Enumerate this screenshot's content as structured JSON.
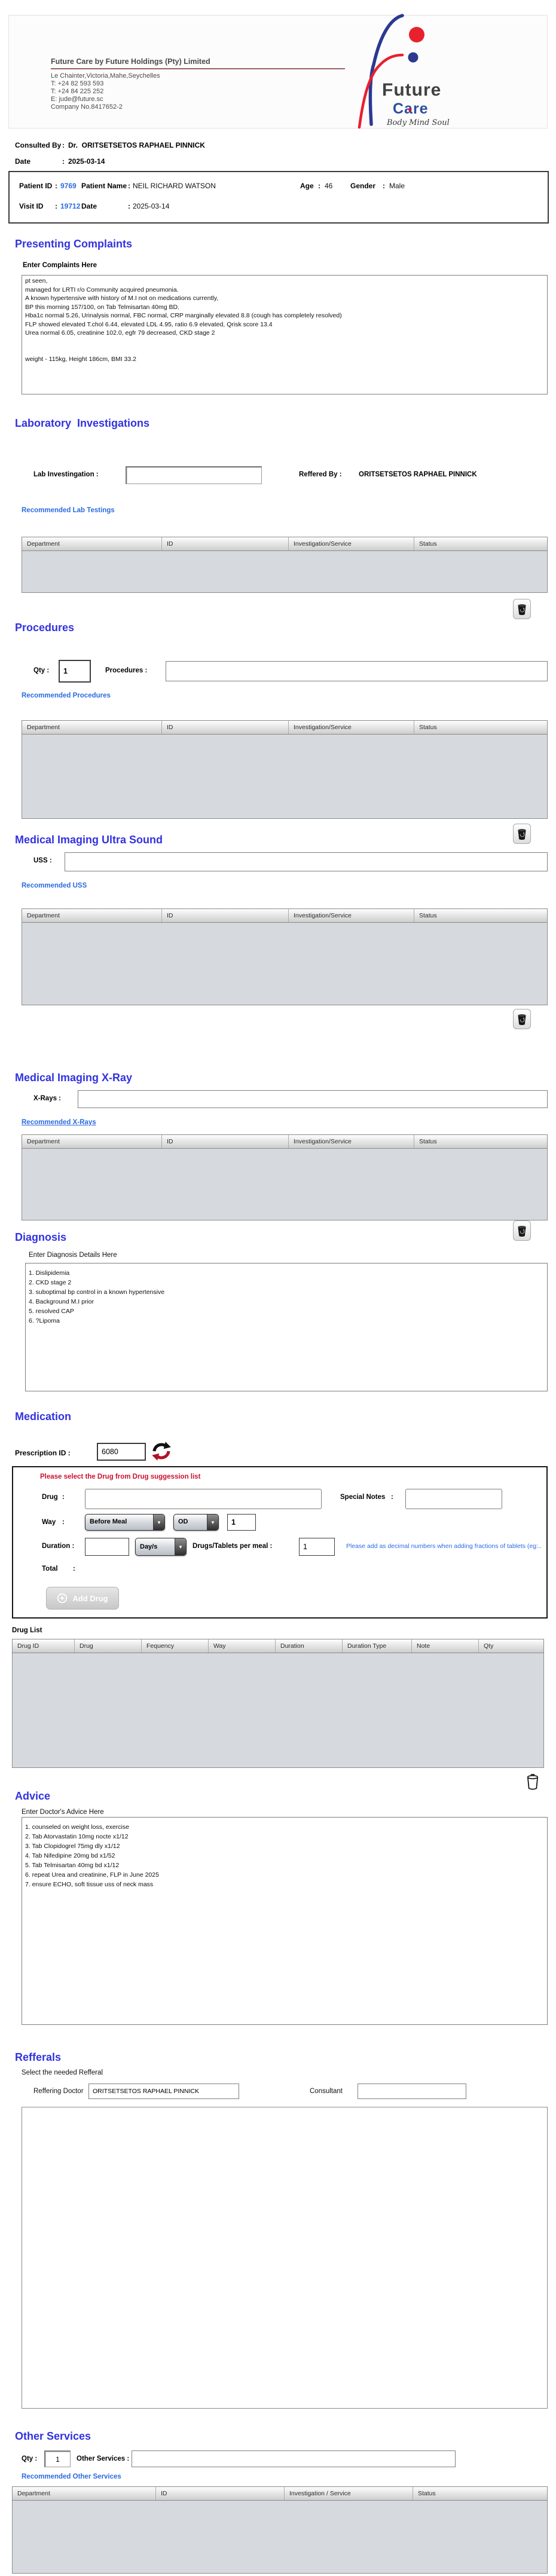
{
  "colon": ":",
  "colors": {
    "section_title_blue": "#3232e0",
    "link_blue": "#2b6be0",
    "alert_red": "#cc1130",
    "letterhead_underline": "#9a5f63",
    "logo_blue": "#2b3990",
    "logo_red": "#e8212e",
    "table_body_gray": "#d6dade"
  },
  "letterhead": {
    "company": "Future Care by Future Holdings (Pty) Limited",
    "address_lines": "Le Chainter,Victoria,Mahe,Seychelles\nT: +24  82 593 593\nT: +24  84 225 252\nE: jude@future.sc\nCompany No.8417652-2",
    "logo": {
      "word_future": "Future",
      "word_care": "Care",
      "tagline": "Body Mind Soul",
      "heart_icon": "heart-icon"
    }
  },
  "consultation": {
    "consulted_by_label": "Consulted By",
    "consulted_by_value": "Dr.  ORITSETSETOS RAPHAEL PINNICK",
    "date_label": "Date",
    "date_value": "2025-03-14"
  },
  "patient": {
    "patient_id_label": "Patient ID",
    "patient_id": "9769",
    "patient_name_label": "Patient Name",
    "patient_name": "NEIL RICHARD WATSON",
    "age_label": "Age",
    "age": "46",
    "gender_label": "Gender",
    "gender": "Male",
    "visit_id_label": "Visit ID",
    "visit_id": "19712",
    "date_label": "Date",
    "date": "2025-03-14"
  },
  "tables": {
    "standard": [
      "Department",
      "ID",
      "Investigation/Service",
      "Status"
    ],
    "other": [
      "Department",
      "ID",
      "Investigation / Service",
      "Status"
    ],
    "drug_list": [
      "Drug ID",
      "Drug",
      "Fequency",
      "Way",
      "Duration",
      "Duration Type",
      "Note",
      "Qty"
    ]
  },
  "presenting_complaints": {
    "title": "Presenting Complaints",
    "subtitle": "Enter Complaints Here",
    "text": "pt seen,\nmanaged for LRTI r/o Community acquired pneumonia.\nA known hypertensive with history of M.I not on medications currently,\nBP this morning 157/100, on Tab Telmisartan 40mg BD.\nHba1c normal 5.26, Urinalysis normal, FBC normal, CRP marginally elevated 8.8 (cough has completely resolved)\nFLP showed elevated T.chol 6.44, elevated LDL 4.95, ratio 6.9 elevated, Qrisk score 13.4\nUrea normal 6.05, creatinine 102.0, egfr 79 decreased, CKD stage 2\n\n\nweight - 115kg, Height 186cm, BMI 33.2"
  },
  "laboratory": {
    "title": "Laboratory  Investigations",
    "lab_label": "Lab Investingation :",
    "reffered_by_label": "Reffered By :",
    "reffered_by_value": "ORITSETSETOS RAPHAEL PINNICK",
    "recommended_label": "Recommended Lab Testings"
  },
  "procedures": {
    "title": "Procedures",
    "qty_label": "Qty :",
    "qty_value": "1",
    "procedures_label": "Procedures :",
    "recommended_label": "Recommended Procedures"
  },
  "uss": {
    "title": "Medical Imaging Ultra Sound",
    "uss_label": "USS :",
    "recommended_label": "Recommended USS"
  },
  "xray": {
    "title": "Medical Imaging X-Ray",
    "xray_label": "X-Rays :",
    "recommended_label": "Recommended X-Rays"
  },
  "diagnosis": {
    "title": "Diagnosis",
    "subtitle": "Enter Diagnosis Details Here",
    "text": "1. Dislipidemia\n2. CKD stage 2\n3. suboptimal bp control in a known hypertensive\n4. Background M.I prior\n5. resolved CAP\n6. ?Lipoma"
  },
  "medication": {
    "title": "Medication",
    "prescription_label": "Prescription ID :",
    "prescription_id": "6080",
    "hint_red": "Please select the Drug from Drug suggession list",
    "drug_label": "Drug",
    "special_notes_label": "Special Notes",
    "way_label": "Way",
    "way_value": "Before Meal",
    "frequency_value": "OD",
    "way_qty": "1",
    "duration_label": "Duration :",
    "duration_unit": "Day/s",
    "per_meal_label": "Drugs/Tablets per meal :",
    "per_meal_value": "1",
    "hint_blue": "Please add as decimal numbers when adding fractions of tablets (eg:..",
    "total_label": "Total",
    "add_drug_label": "Add Drug",
    "drug_list_label": "Drug List"
  },
  "advice": {
    "title": "Advice",
    "subtitle": "Enter Doctor's Advice Here",
    "text": "1. counseled on weight loss, exercise\n2. Tab Atorvastatin 10mg nocte x1/12\n3. Tab Clopidogrel 75mg dly x1/12\n4. Tab Nifedipine 20mg bd x1/52\n5. Tab Telmisartan 40mg bd x1/12\n6. repeat Urea and creatinine, FLP in June 2025\n7. ensure ECHO, soft tissue uss of neck mass"
  },
  "refferals": {
    "title": "Refferals",
    "subtitle": "Select the needed Refferal",
    "reffering_doctor_label": "Reffering Doctor",
    "reffering_doctor_value": "ORITSETSETOS RAPHAEL PINNICK",
    "consultant_label": "Consultant"
  },
  "other_services": {
    "title": "Other Services",
    "qty_label": "Qty :",
    "qty_value": "1",
    "services_label": "Other Services :",
    "recommended_label": "Recommended Other Services"
  }
}
